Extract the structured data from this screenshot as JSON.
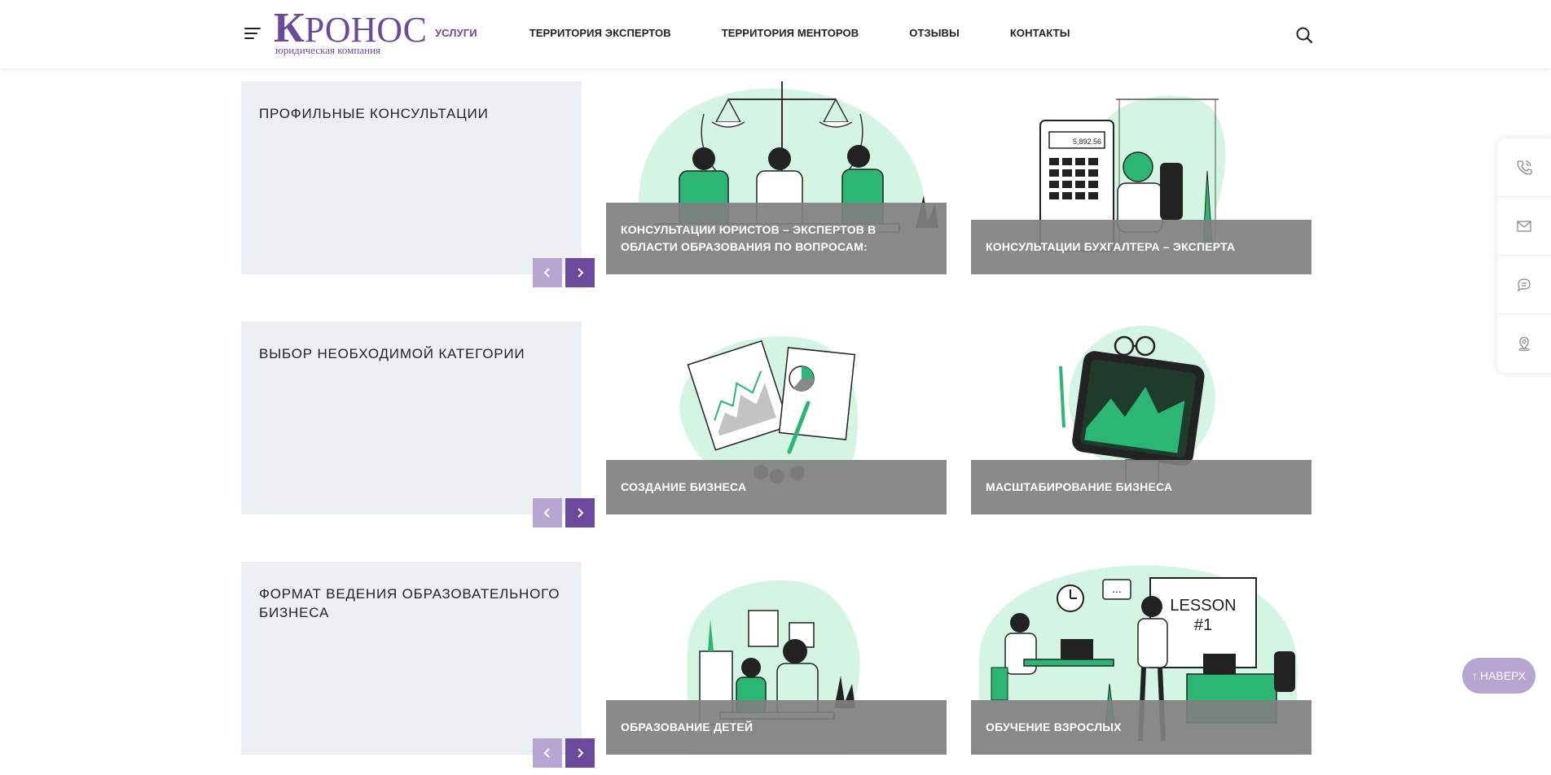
{
  "header": {
    "logo_main": "Кронос",
    "logo_sub": "юридическая компания",
    "nav": [
      {
        "label": "УСЛУГИ",
        "active": true
      },
      {
        "label": "ТЕРРИТОРИЯ ЭКСПЕРТОВ",
        "active": false
      },
      {
        "label": "ТЕРРИТОРИЯ МЕНТОРОВ",
        "active": false
      },
      {
        "label": "ОТЗЫВЫ",
        "active": false
      },
      {
        "label": "КОНТАКТЫ",
        "active": false
      }
    ],
    "icons": {
      "menu": "hamburger-icon",
      "search": "search-icon"
    }
  },
  "rows": [
    {
      "category": "ПРОФИЛЬНЫЕ КОНСУЛЬТАЦИИ",
      "cards": [
        {
          "label": "КОНСУЛЬТАЦИИ ЮРИСТОВ – ЭКСПЕРТОВ В ОБЛАСТИ ОБРАЗОВАНИЯ ПО ВОПРОСАМ:",
          "illustration": "lawyers-at-table"
        },
        {
          "label": "КОНСУЛЬТАЦИИ БУХГАЛТЕРА – ЭКСПЕРТА",
          "illustration": "accountant-with-calculator"
        }
      ]
    },
    {
      "category": "ВЫБОР НЕОБХОДИМОЙ КАТЕГОРИИ",
      "cards": [
        {
          "label": "СОЗДАНИЕ БИЗНЕСА",
          "illustration": "documents-with-charts"
        },
        {
          "label": "МАСШТАБИРОВАНИЕ БИЗНЕСА",
          "illustration": "tablet-with-graph"
        }
      ]
    },
    {
      "category": "ФОРМАТ ВЕДЕНИЯ ОБРАЗОВАТЕЛЬНОГО БИЗНЕСА",
      "cards": [
        {
          "label": "ОБРАЗОВАНИЕ ДЕТЕЙ",
          "illustration": "father-and-child-studying"
        },
        {
          "label": "ОБУЧЕНИЕ ВЗРОСЛЫХ",
          "illustration": "adult-lesson"
        }
      ]
    }
  ],
  "side_panel": [
    "phone-icon",
    "mail-icon",
    "chat-icon",
    "location-icon"
  ],
  "to_top_label": "НАВЕРХ",
  "colors": {
    "accent": "#6b4a9b",
    "accent_light": "#b6a6d1",
    "mint": "#d4f5e4",
    "green": "#2bb673",
    "panel": "#edf0f3",
    "overlay": "#808080"
  }
}
